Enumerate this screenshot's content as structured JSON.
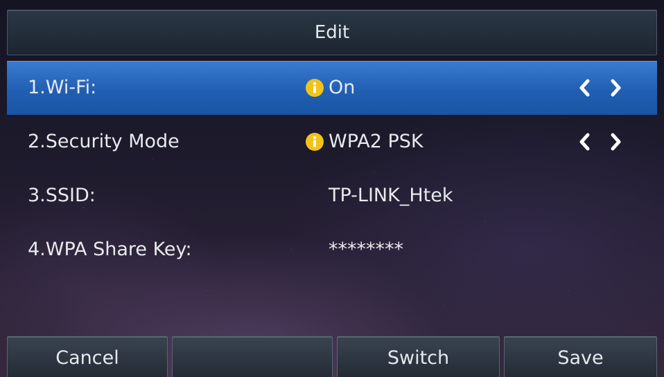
{
  "header": {
    "title": "Edit"
  },
  "rows": [
    {
      "label": "1.Wi-Fi:",
      "value": "On",
      "has_info_icon": true,
      "has_arrows": true,
      "selected": true
    },
    {
      "label": "2.Security Mode",
      "value": "WPA2 PSK",
      "has_info_icon": true,
      "has_arrows": true,
      "selected": false
    },
    {
      "label": "3.SSID:",
      "value": "TP-LINK_Htek",
      "has_info_icon": false,
      "has_arrows": false,
      "selected": false
    },
    {
      "label": "4.WPA Share Key:",
      "value": "********",
      "has_info_icon": false,
      "has_arrows": false,
      "selected": false
    }
  ],
  "softkeys": [
    {
      "label": "Cancel"
    },
    {
      "label": ""
    },
    {
      "label": "Switch"
    },
    {
      "label": "Save"
    }
  ],
  "icons": {
    "info": "info-icon",
    "left": "chevron-left-icon",
    "right": "chevron-right-icon"
  },
  "colors": {
    "selection": "#2a68bd",
    "info_icon": "#f2c318",
    "text": "#e8eaee"
  }
}
